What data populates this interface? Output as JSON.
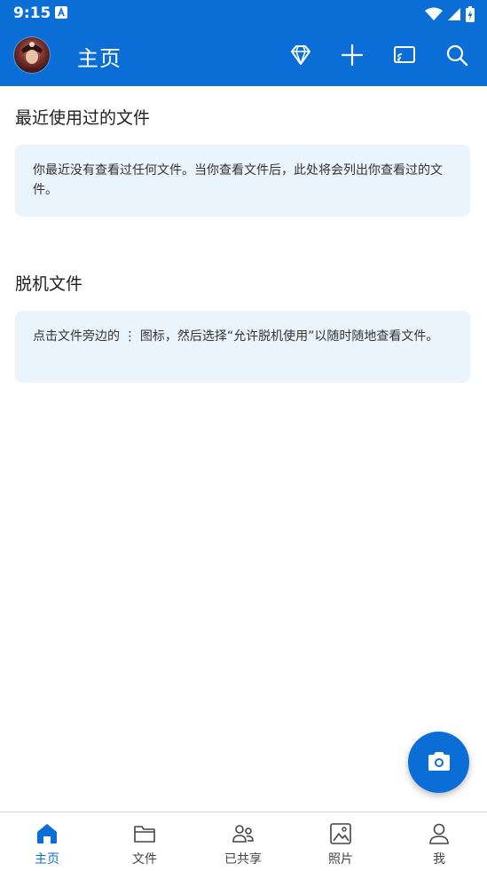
{
  "status_bar": {
    "time": "9:15"
  },
  "app_bar": {
    "title": "主页"
  },
  "sections": {
    "recent": {
      "title": "最近使用过的文件",
      "message": "你最近没有查看过任何文件。当你查看文件后，此处将会列出你查看过的文件。"
    },
    "offline": {
      "title": "脱机文件",
      "message": "点击文件旁边的 ⋮ 图标，然后选择“允许脱机使用”以随时随地查看文件。"
    }
  },
  "bottom_nav": {
    "items": [
      {
        "label": "主页",
        "icon": "home-icon",
        "active": true
      },
      {
        "label": "文件",
        "icon": "folder-icon"
      },
      {
        "label": "已共享",
        "icon": "people-icon"
      },
      {
        "label": "照片",
        "icon": "photo-icon"
      },
      {
        "label": "我",
        "icon": "person-icon"
      }
    ]
  },
  "colors": {
    "accent": "#0a6ed6",
    "card_background": "#e9f4fc"
  }
}
